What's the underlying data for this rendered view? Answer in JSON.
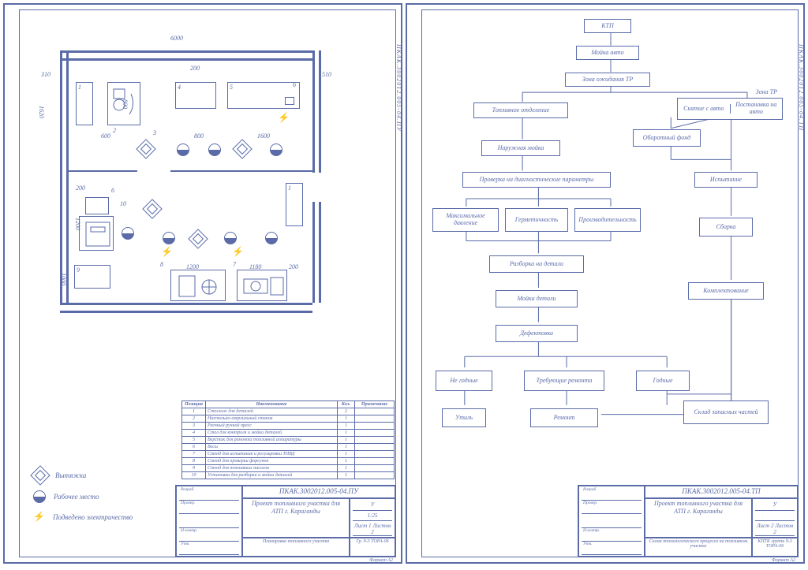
{
  "side_code_left": "ПКАК.3002012.005-04.ПУ",
  "side_code_right": "ПКАК.3002012.005-04.ТП",
  "legend": {
    "vent": "Вытяжка",
    "worker": "Рабочее место",
    "elec": "Подведено электричество"
  },
  "dims": {
    "d6000": "6000",
    "d310": "310",
    "d1620": "1620",
    "d200a": "200",
    "d510": "510",
    "d600": "600",
    "d800a": "800",
    "d800b": "800",
    "d1600": "1600",
    "d200b": "200",
    "d1200a": "1200",
    "d1200b": "1200",
    "d1180": "1180",
    "d200c": "200",
    "d1000": "1000"
  },
  "eq_nums": {
    "n1": "1",
    "n2": "2",
    "n3": "3",
    "n4": "4",
    "n5": "5",
    "n6": "6",
    "n7": "7",
    "n8": "8",
    "n9": "9",
    "n10": "10"
  },
  "parts": {
    "head": {
      "pos": "Позиция",
      "name": "Наименование",
      "qty": "Кол.",
      "note": "Примечание"
    },
    "rows": [
      {
        "pos": "1",
        "name": "Стеллаж для деталей",
        "qty": "2",
        "note": ""
      },
      {
        "pos": "2",
        "name": "Настольно-сверлильный станок",
        "qty": "1",
        "note": ""
      },
      {
        "pos": "3",
        "name": "Реечный ручной пресс",
        "qty": "1",
        "note": ""
      },
      {
        "pos": "4",
        "name": "Стол для контроля и мойки деталей",
        "qty": "1",
        "note": ""
      },
      {
        "pos": "5",
        "name": "Верстак для ремонта топливной аппаратуры",
        "qty": "1",
        "note": ""
      },
      {
        "pos": "6",
        "name": "Весы",
        "qty": "1",
        "note": ""
      },
      {
        "pos": "7",
        "name": "Стенд для испытания и регулировки ТНВД",
        "qty": "1",
        "note": ""
      },
      {
        "pos": "8",
        "name": "Стенд для проверки форсунок",
        "qty": "1",
        "note": ""
      },
      {
        "pos": "9",
        "name": "Стенд для топливных насосов",
        "qty": "1",
        "note": ""
      },
      {
        "pos": "10",
        "name": "Установка для разборки и мойки деталей",
        "qty": "1",
        "note": ""
      }
    ]
  },
  "titleblock_left": {
    "code": "ПКАК.3002012.005-04.ПУ",
    "title": "Проект топливного участка для АТП г. Караганды",
    "sub": "Планировка топливного участка",
    "scale_lit": "У",
    "scale": "1:25",
    "sheets": "Лист 1   Листов 2",
    "org": "Гр. 9-3 ТОРА-06",
    "sign": [
      "Разраб.",
      "Провер.",
      "",
      "Н.контр.",
      "Утв."
    ]
  },
  "titleblock_right": {
    "code": "ПКАК.3002012.005-04.ТП",
    "title": "Проект топливного участка для АТП г. Караганды",
    "sub": "Схема технологического процесса на топливном участке",
    "scale_lit": "У",
    "scale": "",
    "sheets": "Лист 2   Листов 2",
    "org": "КПТК группа 9-3 ТОРА-06",
    "sign": [
      "Разраб.",
      "Провер.",
      "",
      "Н.контр.",
      "Утв."
    ]
  },
  "format": "Формат А2",
  "flow": {
    "ktp": "КТП",
    "wash": "Мойка авто",
    "wait": "Зона ожидания ТР",
    "zone_tr": "Зона ТР",
    "zone_tr_l": "Снятие с авто",
    "zone_tr_r": "Постановка на авто",
    "fuel_dept": "Топливное отделение",
    "rev_fund": "Оборотный фонд",
    "ext_wash": "Наружная мойка",
    "test": "Испытание",
    "diag": "Проверка на диагностические параметры",
    "maxp": "Максимальное давление",
    "herm": "Герметичность",
    "prod": "Производительность",
    "assembly": "Сборка",
    "disasm": "Разборка на детали",
    "part_wash": "Мойка детали",
    "kit": "Комплектование",
    "defect": "Дефектовка",
    "bad": "Не годные",
    "need_rep": "Требующие ремонта",
    "good": "Годные",
    "scrap": "Утиль",
    "repair": "Ремонт",
    "spares": "Склад запасных частей"
  }
}
